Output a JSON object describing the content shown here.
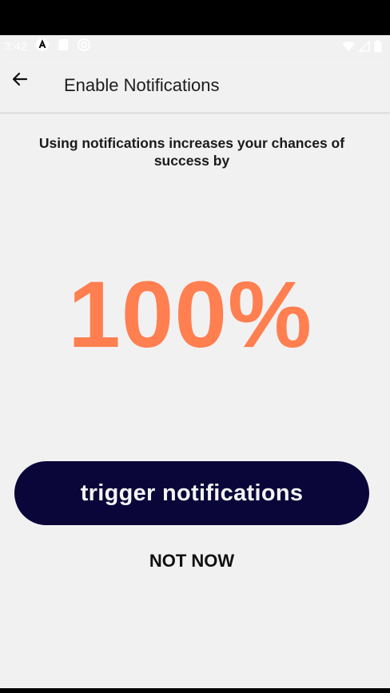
{
  "status_bar": {
    "time": "3:42",
    "left_icons": [
      "a-icon",
      "sd-card-icon",
      "at-sign-icon"
    ],
    "right_icons": [
      "wifi-icon",
      "signal-icon",
      "battery-icon"
    ]
  },
  "app_bar": {
    "title": "Enable Notifications"
  },
  "content": {
    "intro_text": "Using notifications increases your chances of success by",
    "percent": "100%",
    "trigger_label": "trigger notifications",
    "not_now_label": "NOT NOW"
  },
  "colors": {
    "accent": "#ff7f50",
    "button": "#0a0639",
    "background": "#f2f1f2"
  }
}
